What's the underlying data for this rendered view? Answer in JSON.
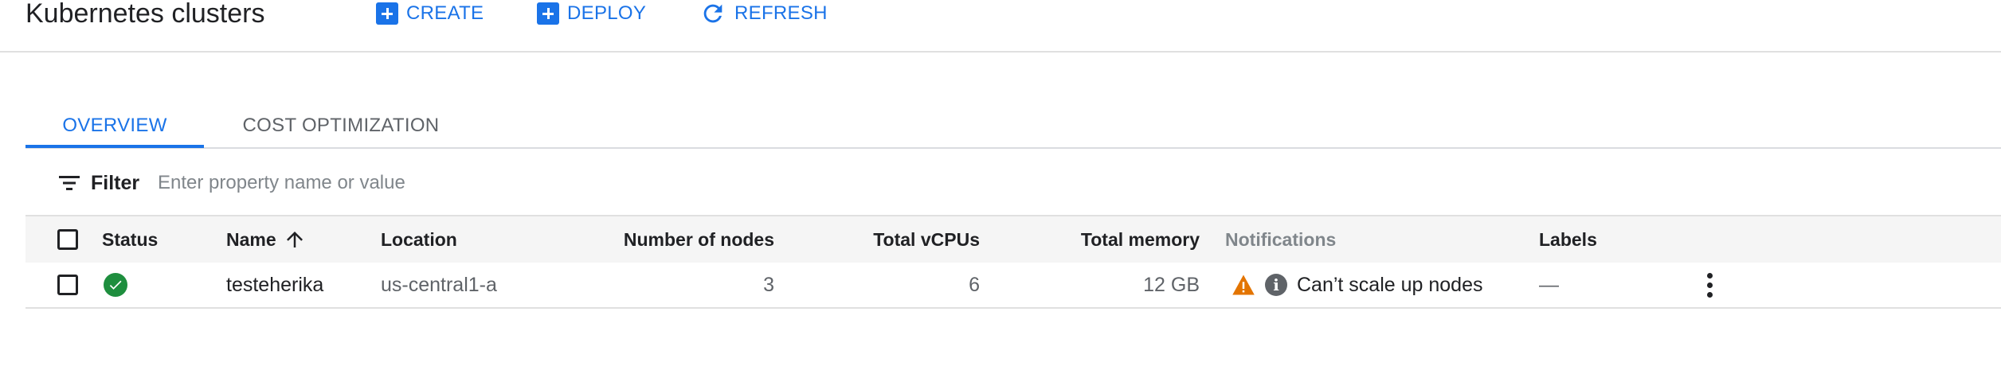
{
  "header": {
    "title": "Kubernetes clusters",
    "actions": [
      {
        "label": "CREATE",
        "icon": "add-box-icon"
      },
      {
        "label": "DEPLOY",
        "icon": "add-box-icon"
      },
      {
        "label": "REFRESH",
        "icon": "refresh-icon"
      }
    ]
  },
  "tabs": [
    {
      "label": "OVERVIEW",
      "active": true
    },
    {
      "label": "COST OPTIMIZATION",
      "active": false
    }
  ],
  "filter": {
    "label": "Filter",
    "placeholder": "Enter property name or value",
    "value": ""
  },
  "table": {
    "columns": {
      "status": "Status",
      "name": "Name",
      "location": "Location",
      "nodes": "Number of nodes",
      "vcpus": "Total vCPUs",
      "memory": "Total memory",
      "notifications": "Notifications",
      "labels": "Labels"
    },
    "sort": {
      "column": "name",
      "direction": "ascending"
    },
    "rows": [
      {
        "status": "ok",
        "name": "testeherika",
        "location": "us-central1-a",
        "nodes": "3",
        "vcpus": "6",
        "memory": "12 GB",
        "notification": "Can’t scale up nodes",
        "labels": "—"
      }
    ]
  },
  "colors": {
    "accent": "#1a73e8",
    "status_ok": "#1e8e3e",
    "warning": "#e37400",
    "info": "#5f6368"
  }
}
